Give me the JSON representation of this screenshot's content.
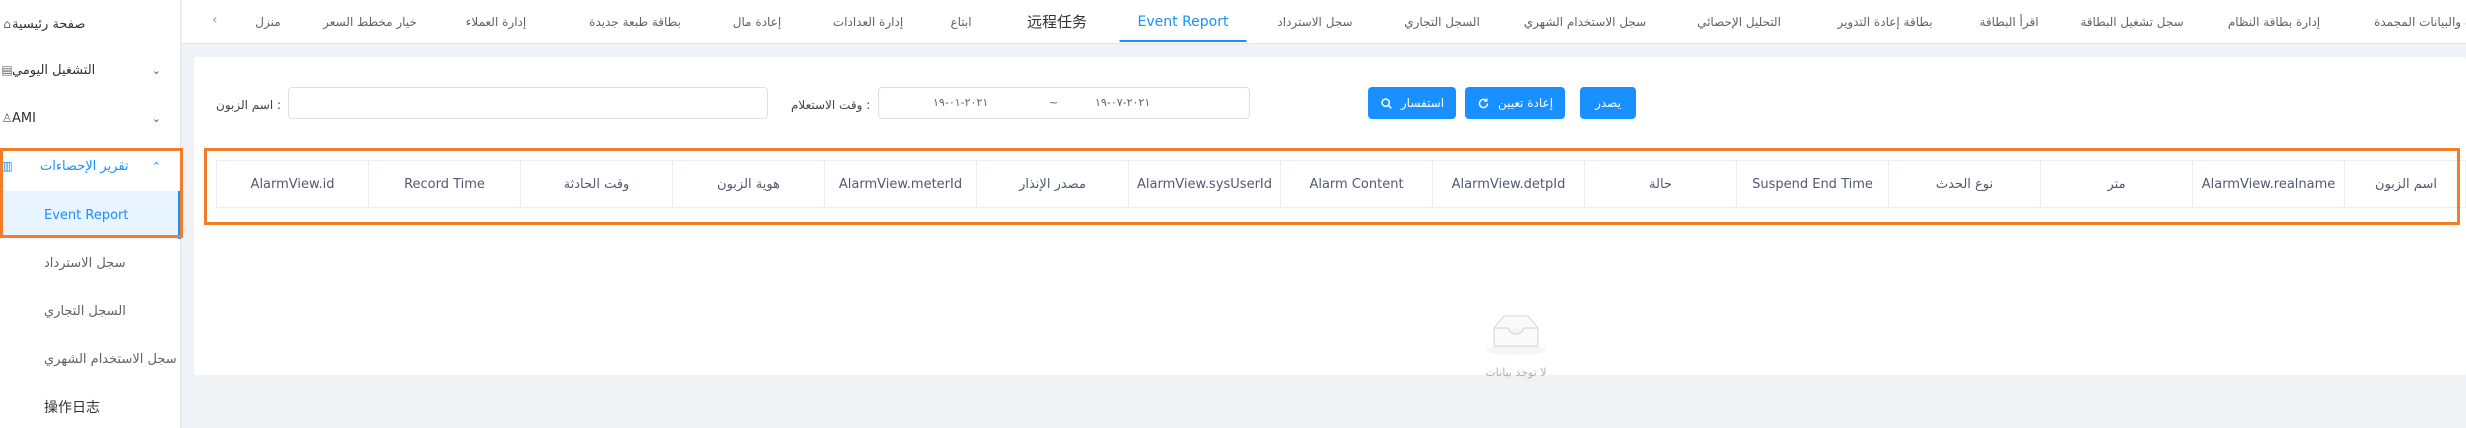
{
  "sidebar": {
    "items": [
      {
        "label": "صفحة رئيسية",
        "icon": "home-icon"
      },
      {
        "label": "التشغيل اليومي",
        "icon": "document-icon"
      },
      {
        "label": "AMI",
        "icon": "user-icon"
      },
      {
        "label": "تقرير الإحصاءات",
        "icon": "chart-icon"
      }
    ],
    "subitems": [
      {
        "label": "Event Report"
      },
      {
        "label": "سجل الاسترداد"
      },
      {
        "label": "السجل التجاري"
      },
      {
        "label": "سجل الاستخدام الشهري"
      },
      {
        "label": "操作日志"
      }
    ]
  },
  "tabs": [
    "منزل",
    "خيار مخطط السعر",
    "إدارة العملاء",
    "بطاقة طبعة جديدة",
    "إعادة مال",
    "إدارة العدادات",
    "ابتاع",
    "远程任务",
    "Event Report",
    "سجل الاسترداد",
    "السجل التجاري",
    "سجل الاستخدام الشهري",
    "التحليل الإحصائي",
    "بطاقة إعادة التدوير",
    "اقرأ البطاقة",
    "سجل تشغيل البطاقة",
    "إدارة بطاقة النظام",
    "حدث والبيانات المجمدة"
  ],
  "filters": {
    "customer_name_label": "اسم الزبون :",
    "customer_name_value": "",
    "usage_time_label": "وقت الاستعلام :",
    "date_start": "٢٠٢١-٠١-١٩",
    "date_sep": "~",
    "date_end": "٢٠٢١-٠٧-١٩"
  },
  "buttons": {
    "query": "استفسار",
    "reset": "إعادة تعيين",
    "export": "يصدر"
  },
  "table": {
    "headers": [
      "AlarmView.id",
      "Record Time",
      "وقت الحادثة",
      "هوية الزبون",
      "AlarmView.meterId",
      "مصدر الإنذار",
      "AlarmView.sysUserId",
      "Alarm Content",
      "AlarmView.detpId",
      "حالة",
      "Suspend End Time",
      "نوع الحدث",
      "متر",
      "AlarmView.realname",
      "اسم الزبون"
    ],
    "empty_text": "لا توجد بيانات"
  },
  "colors": {
    "accent": "#1890ff",
    "highlight": "#f07d2a"
  }
}
